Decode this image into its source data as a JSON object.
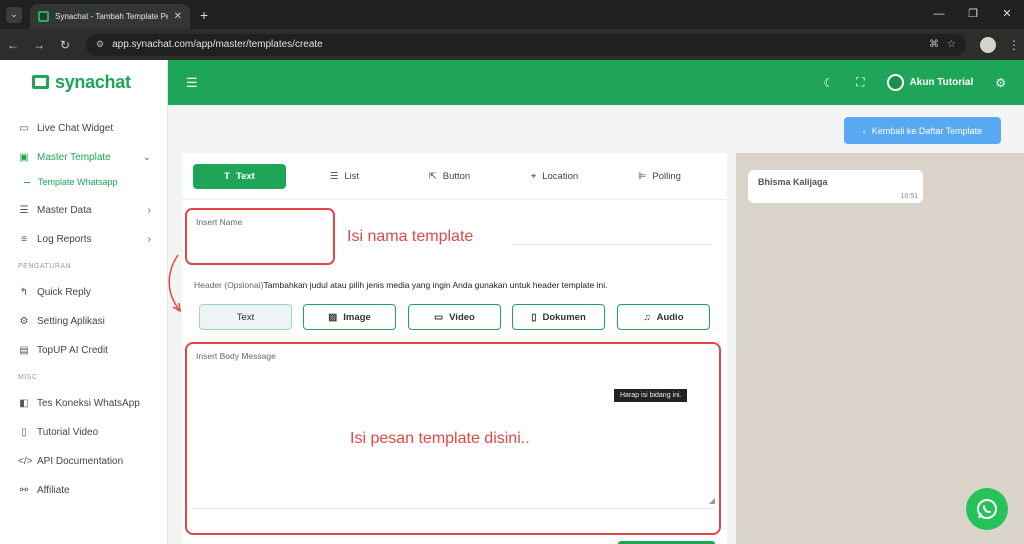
{
  "browser": {
    "tab_title": "Synachat - Tambah Template Pesa",
    "url": "app.synachat.com/app/master/templates/create"
  },
  "sidebar": {
    "brand": "synachat",
    "items": [
      {
        "label": "Live Chat Widget",
        "icon": "chat-widget-icon"
      },
      {
        "label": "Master Template",
        "icon": "template-icon"
      },
      {
        "label": "Master Data",
        "icon": "list-icon"
      },
      {
        "label": "Log Reports",
        "icon": "report-icon"
      }
    ],
    "sub_item": "Template Whatsapp",
    "section_settings": "PENGATURAN",
    "settings_items": [
      {
        "label": "Quick Reply",
        "icon": "reply-icon"
      },
      {
        "label": "Setting Aplikasi",
        "icon": "gear-icon"
      },
      {
        "label": "TopUP AI Credit",
        "icon": "credit-card-icon"
      }
    ],
    "section_misc": "MISC",
    "misc_items": [
      {
        "label": "Tes Koneksi WhatsApp",
        "icon": "whatsapp-icon"
      },
      {
        "label": "Tutorial Video",
        "icon": "video-icon"
      },
      {
        "label": "API Documentation",
        "icon": "code-icon"
      },
      {
        "label": "Affiliate",
        "icon": "network-icon"
      }
    ]
  },
  "topbar": {
    "user": "Akun Tutorial"
  },
  "back_button": "Kembali ke Daftar Template",
  "tabs": [
    "Text",
    "List",
    "Button",
    "Location",
    "Polling"
  ],
  "form": {
    "name_label": "Insert Name",
    "name_annotation": "Isi nama template",
    "header_label": "Header (Opsional)",
    "header_hint": "Tambahkan judul atau pilih jenis media yang ingin Anda gunakan untuk header template ini.",
    "media_buttons": [
      "Text",
      "Image",
      "Video",
      "Dokumen",
      "Audio"
    ],
    "body_label": "Insert Body Message",
    "tooltip": "Harap isi bidang ini.",
    "body_annotation": "Isi pesan template disini.."
  },
  "preview": {
    "sender": "Bhisma Kalijaga",
    "time": "10:51"
  }
}
